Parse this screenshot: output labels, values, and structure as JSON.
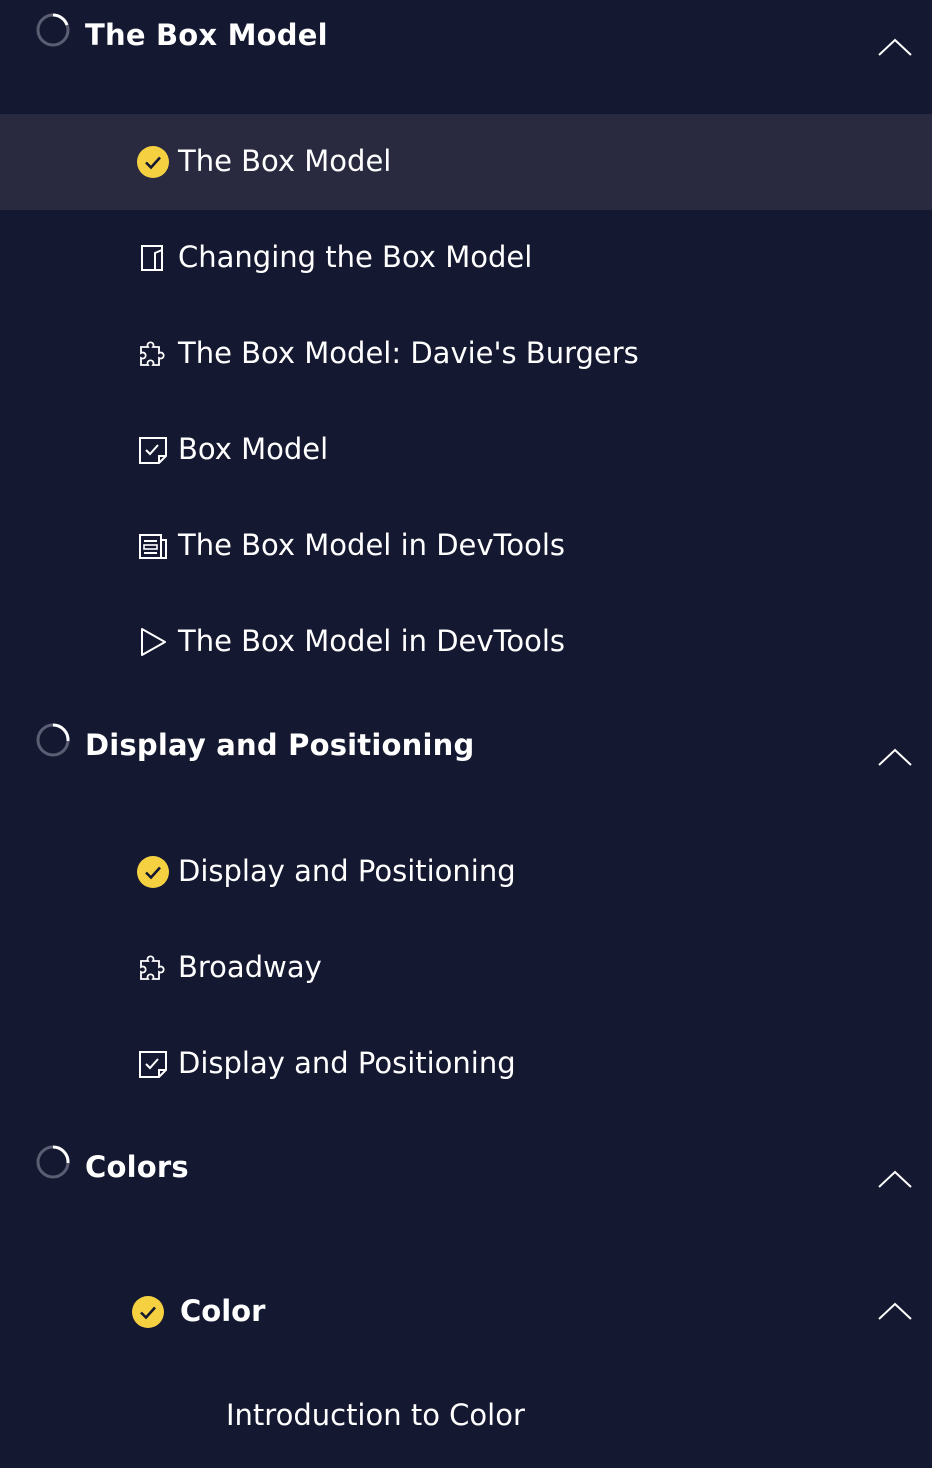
{
  "colors": {
    "background": "#141830",
    "active_row": "#292a40",
    "check": "#f5d142",
    "text": "#ffffff"
  },
  "sections": [
    {
      "title": "The Box Model",
      "expand_icon": "chevron-up-icon",
      "progress_icon": "progress-ring-icon",
      "items": [
        {
          "label": "The Box Model",
          "icon": "check-circle-icon",
          "active": true
        },
        {
          "label": "Changing the Box Model",
          "icon": "article-icon"
        },
        {
          "label": "The Box Model: Davie's Burgers",
          "icon": "puzzle-icon"
        },
        {
          "label": "Box Model",
          "icon": "quiz-icon"
        },
        {
          "label": "The Box Model in DevTools",
          "icon": "document-icon"
        },
        {
          "label": "The Box Model in DevTools",
          "icon": "play-icon"
        }
      ]
    },
    {
      "title": "Display and Positioning",
      "expand_icon": "chevron-up-icon",
      "progress_icon": "progress-ring-icon",
      "items": [
        {
          "label": "Display and Positioning",
          "icon": "check-circle-icon"
        },
        {
          "label": "Broadway",
          "icon": "puzzle-icon"
        },
        {
          "label": "Display and Positioning",
          "icon": "quiz-icon"
        }
      ]
    },
    {
      "title": "Colors",
      "expand_icon": "chevron-up-icon",
      "progress_icon": "progress-ring-icon",
      "subsections": [
        {
          "title": "Color",
          "icon": "check-circle-icon",
          "expand_icon": "chevron-up-icon",
          "items": [
            {
              "label": "Introduction to Color"
            }
          ]
        }
      ]
    }
  ]
}
